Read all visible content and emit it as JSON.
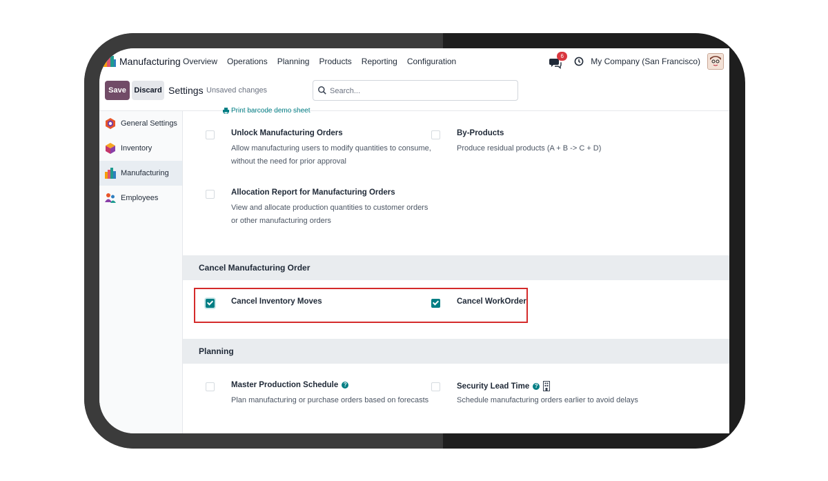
{
  "navbar": {
    "app_name": "Manufacturing",
    "menu": [
      "Overview",
      "Operations",
      "Planning",
      "Products",
      "Reporting",
      "Configuration"
    ],
    "chat_badge": "6",
    "company": "My Company (San Francisco)"
  },
  "control": {
    "save_label": "Save",
    "discard_label": "Discard",
    "title": "Settings",
    "status": "Unsaved changes",
    "search_placeholder": "Search..."
  },
  "sidebar": {
    "items": [
      {
        "label": "General Settings",
        "icon": "general-settings-icon",
        "active": false
      },
      {
        "label": "Inventory",
        "icon": "inventory-icon",
        "active": false
      },
      {
        "label": "Manufacturing",
        "icon": "manufacturing-icon",
        "active": true
      },
      {
        "label": "Employees",
        "icon": "employees-icon",
        "active": false
      }
    ]
  },
  "content": {
    "demo_link": "Print barcode demo sheet",
    "operations": [
      {
        "title": "Unlock Manufacturing Orders",
        "desc": "Allow manufacturing users to modify quantities to consume, without the need for prior approval",
        "checked": false
      },
      {
        "title": "By-Products",
        "desc": "Produce residual products (A + B -> C + D)",
        "checked": false
      },
      {
        "title": "Allocation Report for Manufacturing Orders",
        "desc": "View and allocate production quantities to customer orders or other manufacturing orders",
        "checked": false
      }
    ],
    "cancel_section": {
      "heading": "Cancel Manufacturing Order",
      "items": [
        {
          "title": "Cancel Inventory Moves",
          "checked": true
        },
        {
          "title": "Cancel WorkOrder",
          "checked": true
        }
      ]
    },
    "planning_section": {
      "heading": "Planning",
      "items": [
        {
          "title": "Master Production Schedule",
          "desc": "Plan manufacturing or purchase orders based on forecasts",
          "checked": false
        },
        {
          "title": "Security Lead Time",
          "desc": "Schedule manufacturing orders earlier to avoid delays",
          "checked": false
        }
      ]
    }
  },
  "colors": {
    "brand": "#714b67",
    "accent": "#017e84",
    "highlight_box": "#d42a2a"
  }
}
